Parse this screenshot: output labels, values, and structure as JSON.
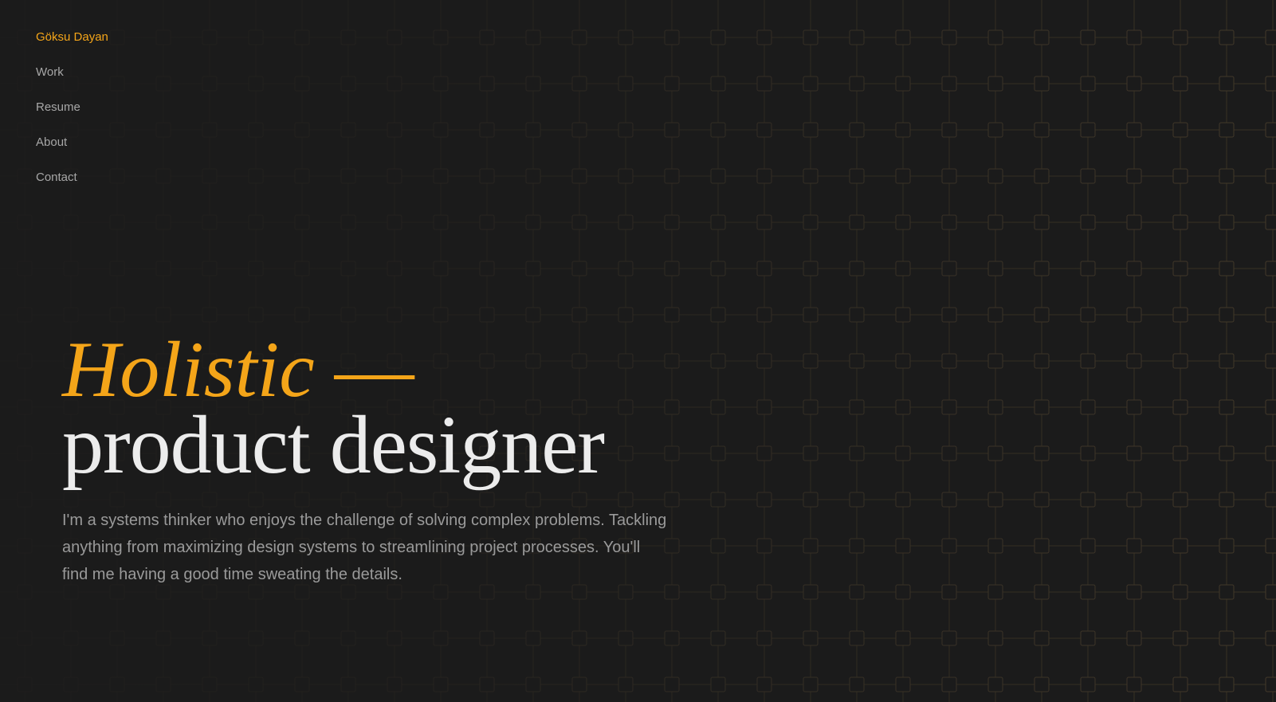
{
  "nav": {
    "brand": "Göksu Dayan",
    "items": [
      {
        "label": "Work"
      },
      {
        "label": "Resume"
      },
      {
        "label": "About"
      },
      {
        "label": "Contact"
      }
    ]
  },
  "hero": {
    "headline_accent": "Holistic",
    "headline_dash": " —",
    "headline_rest": "product designer",
    "intro": "I'm a systems thinker who enjoys the challenge of solving complex problems. Tackling anything from maximizing design systems to streamlining project processes. You'll find me having a good time sweating the details."
  },
  "colors": {
    "background": "#1b1b1b",
    "accent": "#f4a519",
    "headline": "#ececec",
    "body_text": "#9a9a9a",
    "nav_text": "#a7a7a7"
  },
  "background_pattern": "grid-of-squares"
}
